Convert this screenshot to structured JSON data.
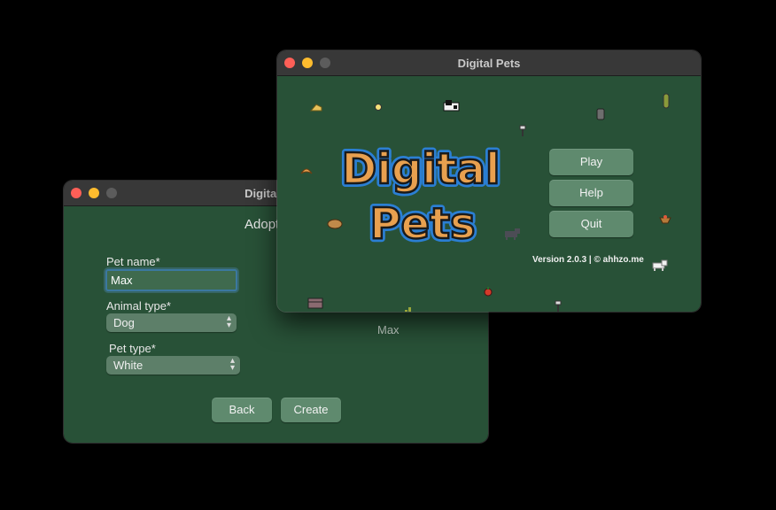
{
  "adopt_window": {
    "title": "Digital Pets",
    "heading": "Adopt",
    "pet_name_label": "Pet name*",
    "pet_name_value": "Max",
    "animal_type_label": "Animal type*",
    "animal_type_value": "Dog",
    "pet_type_label": "Pet type*",
    "pet_type_value": "White",
    "preview_name": "Max",
    "back_label": "Back",
    "create_label": "Create"
  },
  "main_window": {
    "title": "Digital Pets",
    "logo_line1": "Digital",
    "logo_line2": "Pets",
    "play_label": "Play",
    "help_label": "Help",
    "quit_label": "Quit",
    "version_text": "Version 2.0.3 | © ahhzo.me"
  },
  "colors": {
    "window_bg": "#285137",
    "button_bg": "#5f8a6e",
    "logo_fill": "#e8a04f",
    "logo_outline": "#2b7fd3"
  }
}
